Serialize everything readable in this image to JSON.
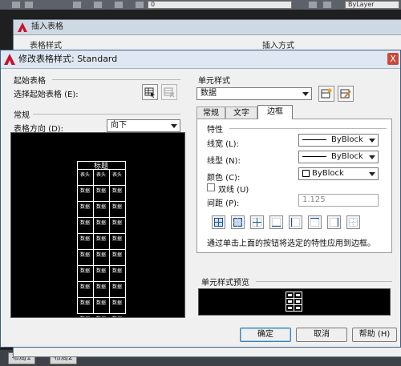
{
  "background": {
    "layer_value": "ByLayer",
    "layer_index": "0",
    "layout_tabs": [
      "布局1",
      "布局2"
    ]
  },
  "insert_dialog": {
    "title": "插入表格",
    "table_style_label": "表格样式",
    "insert_mode_label": "插入方式"
  },
  "dialog": {
    "title": "修改表格样式: Standard",
    "close_label": "X",
    "start_table": {
      "header": "起始表格",
      "select_label": "选择起始表格 (E):"
    },
    "general": {
      "header": "常规",
      "direction_label": "表格方向 (D):",
      "direction_value": "向下"
    },
    "preview_title_text": "标题",
    "preview_header_text": "表头",
    "preview_data_text": "数据",
    "cell_style": {
      "header": "单元样式",
      "selected": "数据",
      "tabs": [
        "常规",
        "文字",
        "边框"
      ],
      "active_tab": "边框"
    },
    "border": {
      "group_label": "特性",
      "lineweight_label": "线宽 (L):",
      "lineweight_value": "ByBlock",
      "linetype_label": "线型 (N):",
      "linetype_value": "ByBlock",
      "color_label": "颜色 (C):",
      "color_value": "ByBlock",
      "double_line_label": "双线 (U)",
      "spacing_label": "间距 (P):",
      "spacing_value": "1.125",
      "hint": "通过单击上面的按钮将选定的特性应用到边框。"
    },
    "cell_preview_header": "单元样式预览",
    "buttons": {
      "ok": "确定",
      "cancel": "取消",
      "help": "帮助 (H)"
    }
  },
  "colors": {
    "title_bar": "#dfe8f2",
    "dialog_bg": "#f0f0f0",
    "preview_bg": "#000000",
    "accent": "#3c7fb1"
  }
}
